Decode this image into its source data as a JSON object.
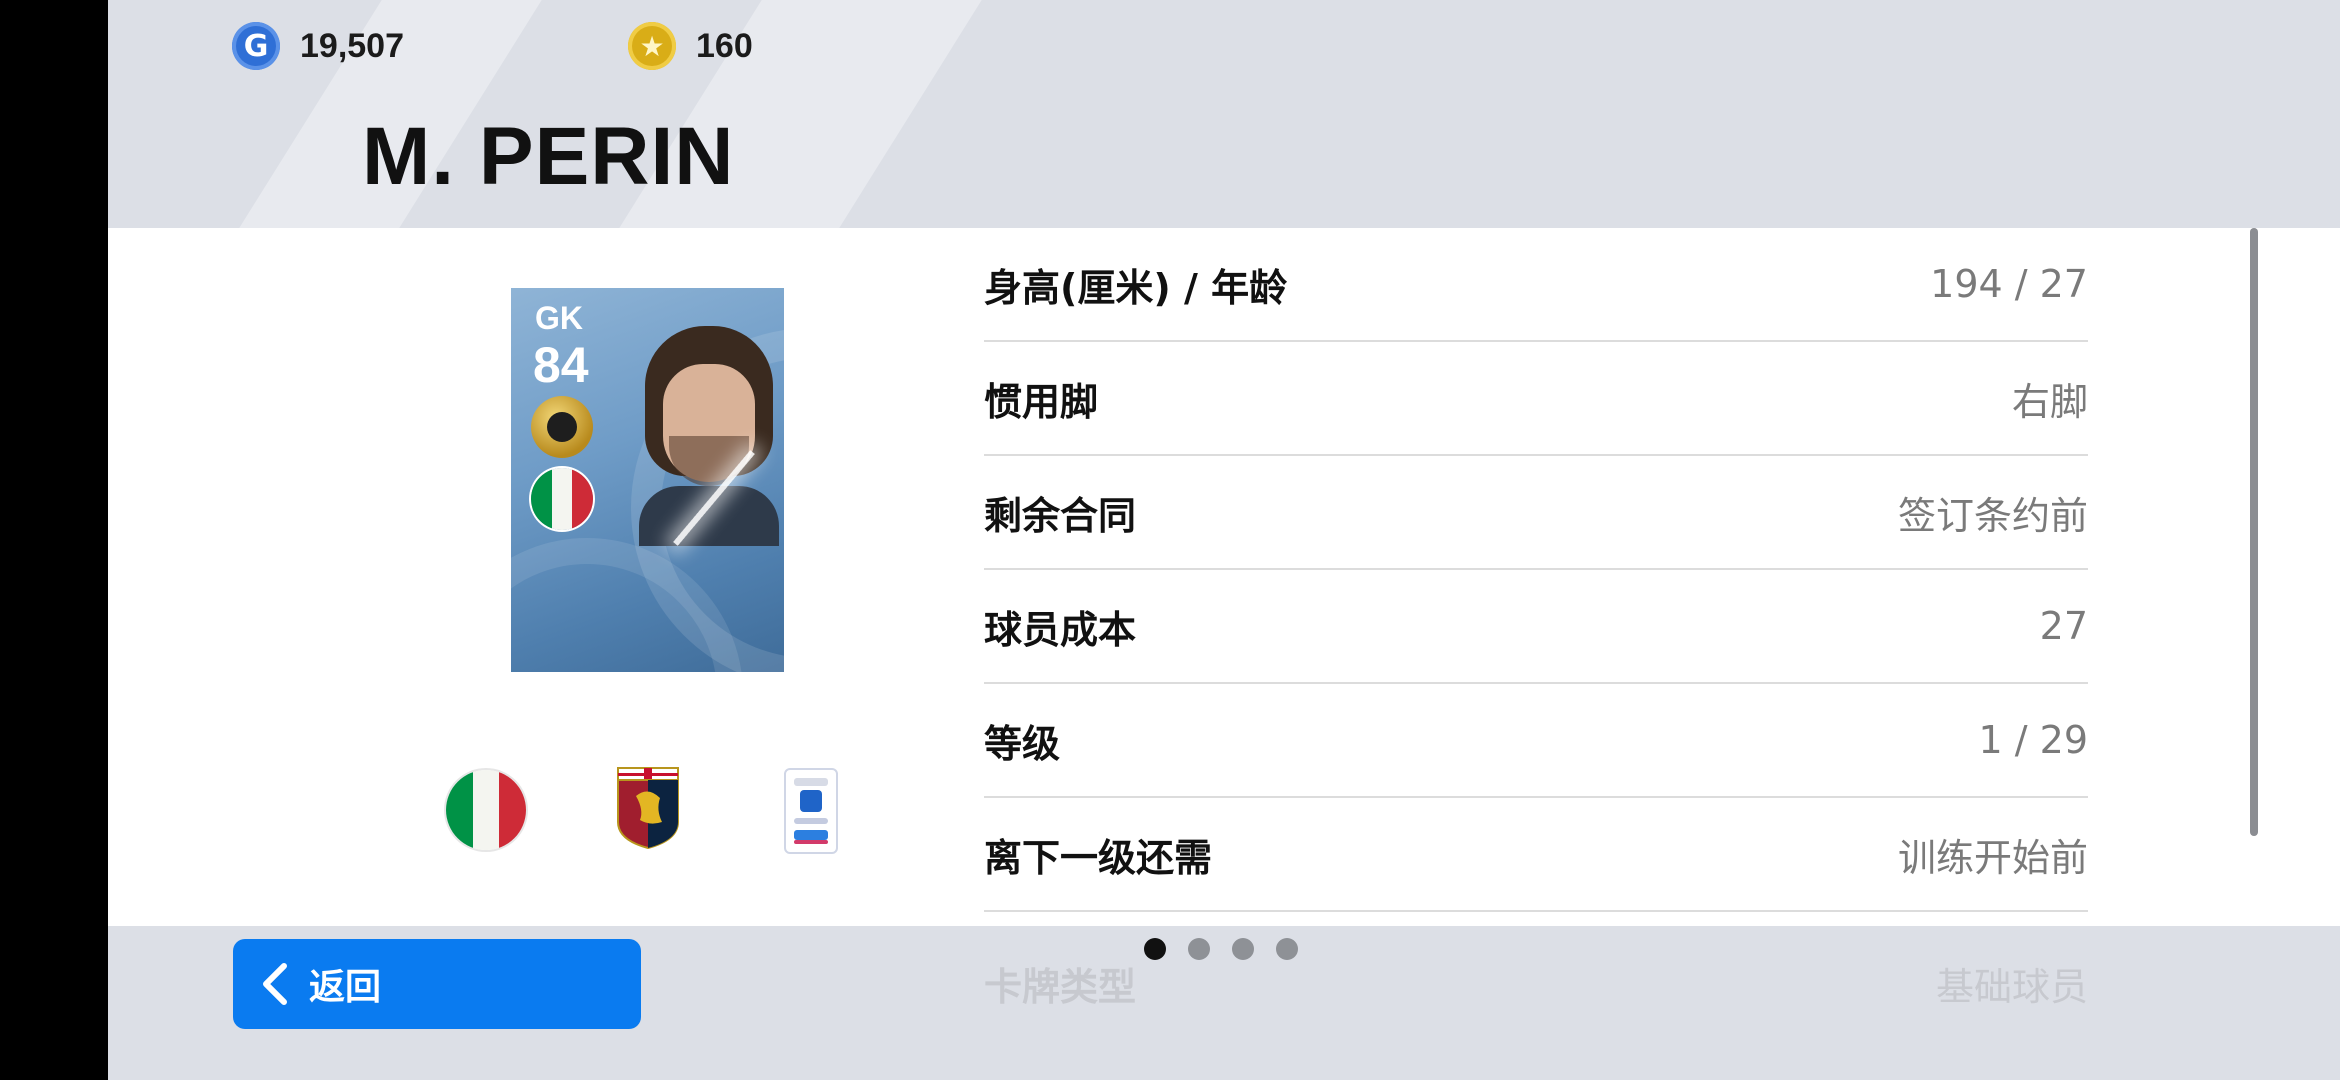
{
  "currencies": {
    "gp": {
      "icon": "g-coin-icon",
      "glyph": "G",
      "amount": "19,507"
    },
    "coins": {
      "icon": "star-coin-icon",
      "glyph": "★",
      "amount": "160"
    }
  },
  "player": {
    "name": "M. PERIN",
    "card": {
      "position": "GK",
      "rating": "84",
      "nationality_icon": "italy-flag-icon",
      "badge_icon": "gold-badge-icon"
    }
  },
  "stats": [
    {
      "label": "身高(厘米) / 年龄",
      "value": "194 / 27"
    },
    {
      "label": "惯用脚",
      "value": "右脚"
    },
    {
      "label": "剩余合同",
      "value": "签订条约前"
    },
    {
      "label": "球员成本",
      "value": "27"
    },
    {
      "label": "等级",
      "value": "1 / 29"
    },
    {
      "label": "离下一级还需",
      "value": "训练开始前"
    },
    {
      "label": "卡牌类型",
      "value": "基础球员"
    }
  ],
  "affiliations": {
    "nation_icon": "italy-flag-icon",
    "club_icon": "genoa-crest-icon",
    "league_icon": "serie-a-logo-icon"
  },
  "footer": {
    "back_label": "返回",
    "pager": {
      "pages": 4,
      "active": 1
    }
  },
  "colors": {
    "accent": "#0a7bf0",
    "background": "#dcdfe6",
    "panel": "#ffffff"
  }
}
